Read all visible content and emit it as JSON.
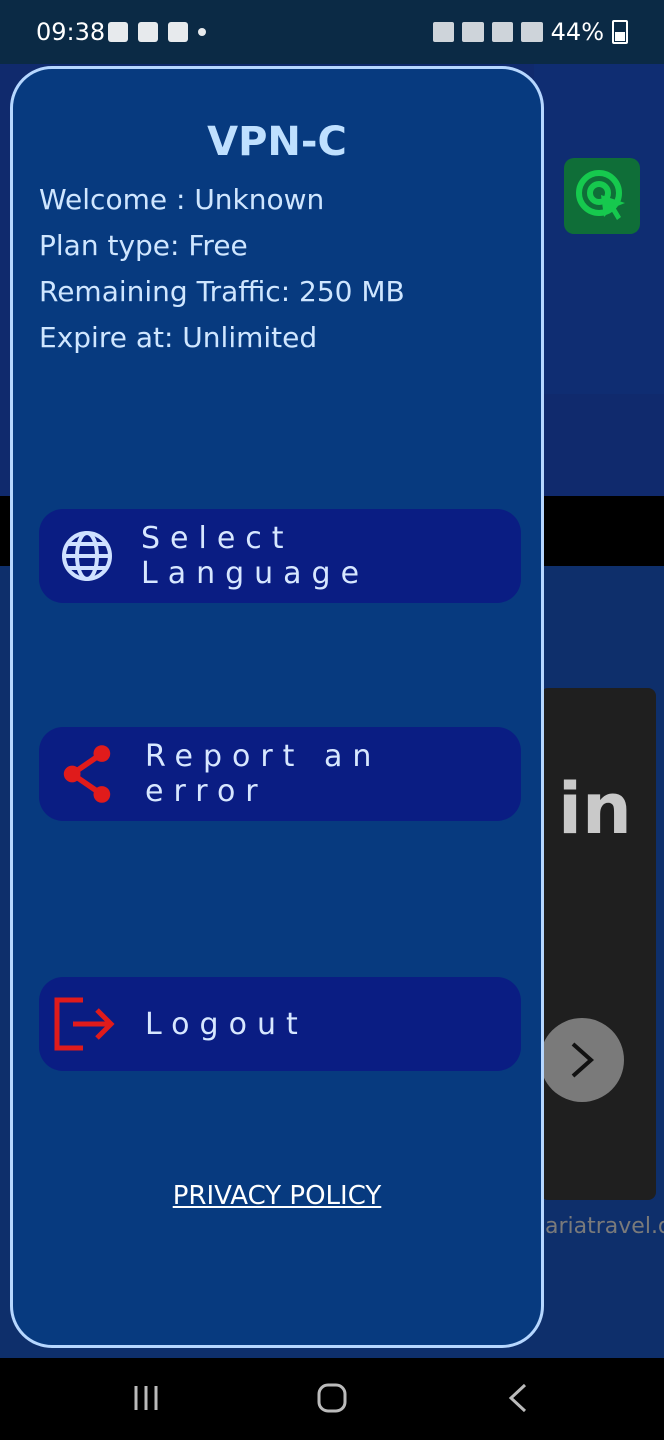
{
  "status_bar": {
    "time": "09:38",
    "battery": "44%"
  },
  "drawer": {
    "title": "VPN-C",
    "welcome": "Welcome : Unknown",
    "plan": "Plan type: Free",
    "traffic": "Remaining Traffic: 250 MB",
    "expire": "Expire at: Unlimited",
    "menu": [
      {
        "label": "Select Language",
        "icon": "globe-icon"
      },
      {
        "label": "Report an error",
        "icon": "share-icon"
      },
      {
        "label": "Logout",
        "icon": "logout-icon"
      }
    ],
    "privacy_link": "PRIVACY POLICY"
  },
  "background": {
    "ad_text": "in",
    "ad_url": "ariatravel.o"
  },
  "colors": {
    "drawer_bg": "#073a7f",
    "button_bg": "#0a1d83",
    "accent_red": "#e01b1b",
    "title_color": "#bfe0ff"
  }
}
